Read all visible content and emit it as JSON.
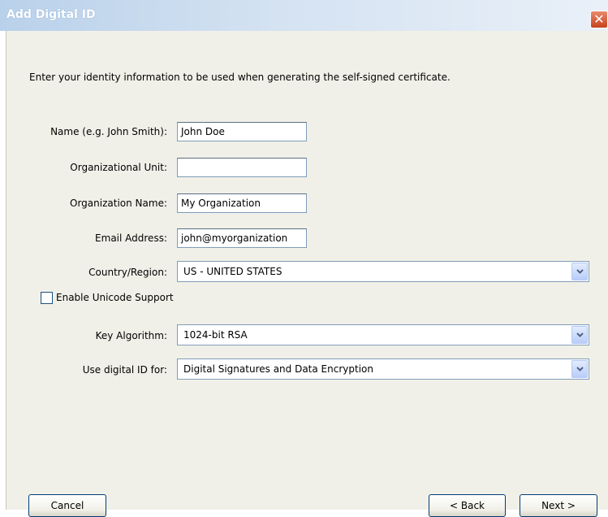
{
  "window": {
    "title": "Add Digital ID",
    "close_symbol": "✕"
  },
  "instructions": "Enter your identity information to be used when generating the self-signed certificate.",
  "fields": {
    "name": {
      "label": "Name (e.g. John Smith):",
      "value": "John Doe"
    },
    "org_unit": {
      "label": "Organizational Unit:",
      "value": ""
    },
    "org_name": {
      "label": "Organization Name:",
      "value": "My Organization"
    },
    "email": {
      "label": "Email Address:",
      "value": "john@myorganization"
    }
  },
  "selects": {
    "country": {
      "label": "Country/Region:",
      "value": "US - UNITED STATES"
    },
    "algorithm": {
      "label": "Key Algorithm:",
      "value": "1024-bit RSA"
    },
    "usage": {
      "label": "Use digital ID for:",
      "value": "Digital Signatures and Data Encryption"
    }
  },
  "unicode": {
    "label": "Enable Unicode Support",
    "checked": false
  },
  "buttons": {
    "cancel": "Cancel",
    "back": "< Back",
    "next": "Next >"
  },
  "icons": {
    "close": "close-icon",
    "dropdown": "chevron-down-icon"
  },
  "colors": {
    "titlebar": "#b9d1ea",
    "dialog_bg": "#f1f0e8",
    "close_button": "#c8441c",
    "field_border": "#7f9db9"
  }
}
